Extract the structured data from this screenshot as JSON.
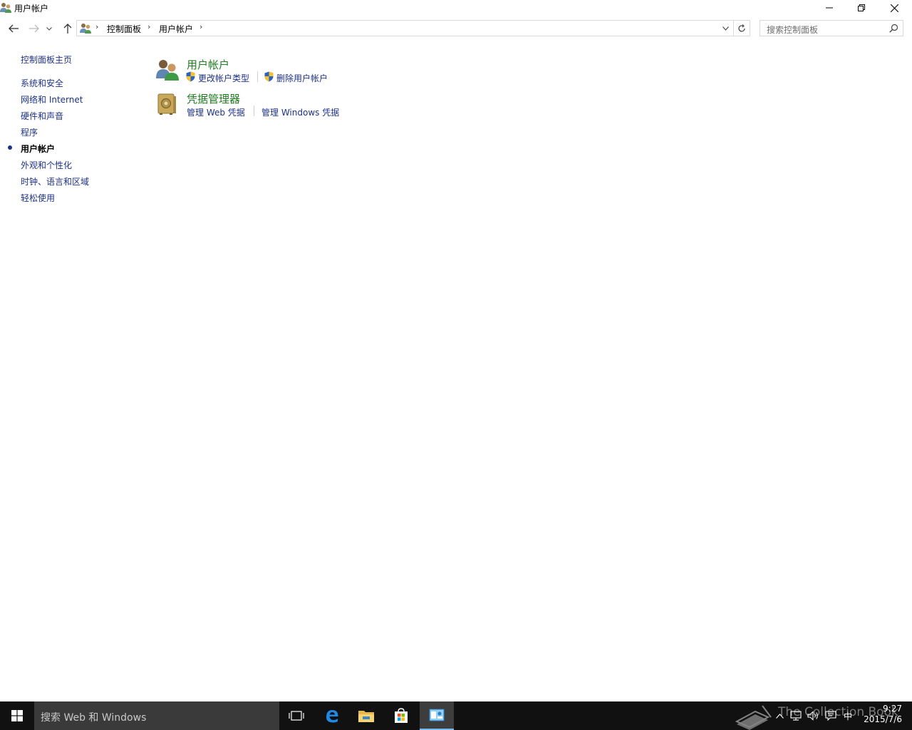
{
  "window": {
    "title": "用户帐户"
  },
  "navbar": {
    "breadcrumbs": [
      "控制面板",
      "用户帐户"
    ],
    "search_placeholder": "搜索控制面板"
  },
  "sidebar": {
    "home_label": "控制面板主页",
    "items": [
      {
        "label": "系统和安全",
        "active": false
      },
      {
        "label": "网络和 Internet",
        "active": false
      },
      {
        "label": "硬件和声音",
        "active": false
      },
      {
        "label": "程序",
        "active": false
      },
      {
        "label": "用户帐户",
        "active": true
      },
      {
        "label": "外观和个性化",
        "active": false
      },
      {
        "label": "时钟、语言和区域",
        "active": false
      },
      {
        "label": "轻松使用",
        "active": false
      }
    ]
  },
  "main": {
    "categories": [
      {
        "title": "用户帐户",
        "icon": "users-icon",
        "links": [
          {
            "label": "更改帐户类型",
            "shield": true
          },
          {
            "label": "删除用户帐户",
            "shield": true
          }
        ]
      },
      {
        "title": "凭据管理器",
        "icon": "vault-icon",
        "links": [
          {
            "label": "管理 Web 凭据",
            "shield": false
          },
          {
            "label": "管理 Windows 凭据",
            "shield": false
          }
        ]
      }
    ]
  },
  "taskbar": {
    "search_text": "搜索 Web 和 Windows",
    "apps": [
      "task-view-icon",
      "edge-icon",
      "file-explorer-icon",
      "store-icon",
      "control-panel-icon"
    ],
    "ime": "中",
    "time": "9:27",
    "date": "2015/7/6",
    "watermark": "The Collection Book"
  },
  "colors": {
    "link": "#1e3287",
    "category_title": "#1e7d1e",
    "taskbar_bg": "#111111",
    "taskbar_search_bg": "#3a3a3a",
    "active_app_underline": "#76b9ed"
  }
}
